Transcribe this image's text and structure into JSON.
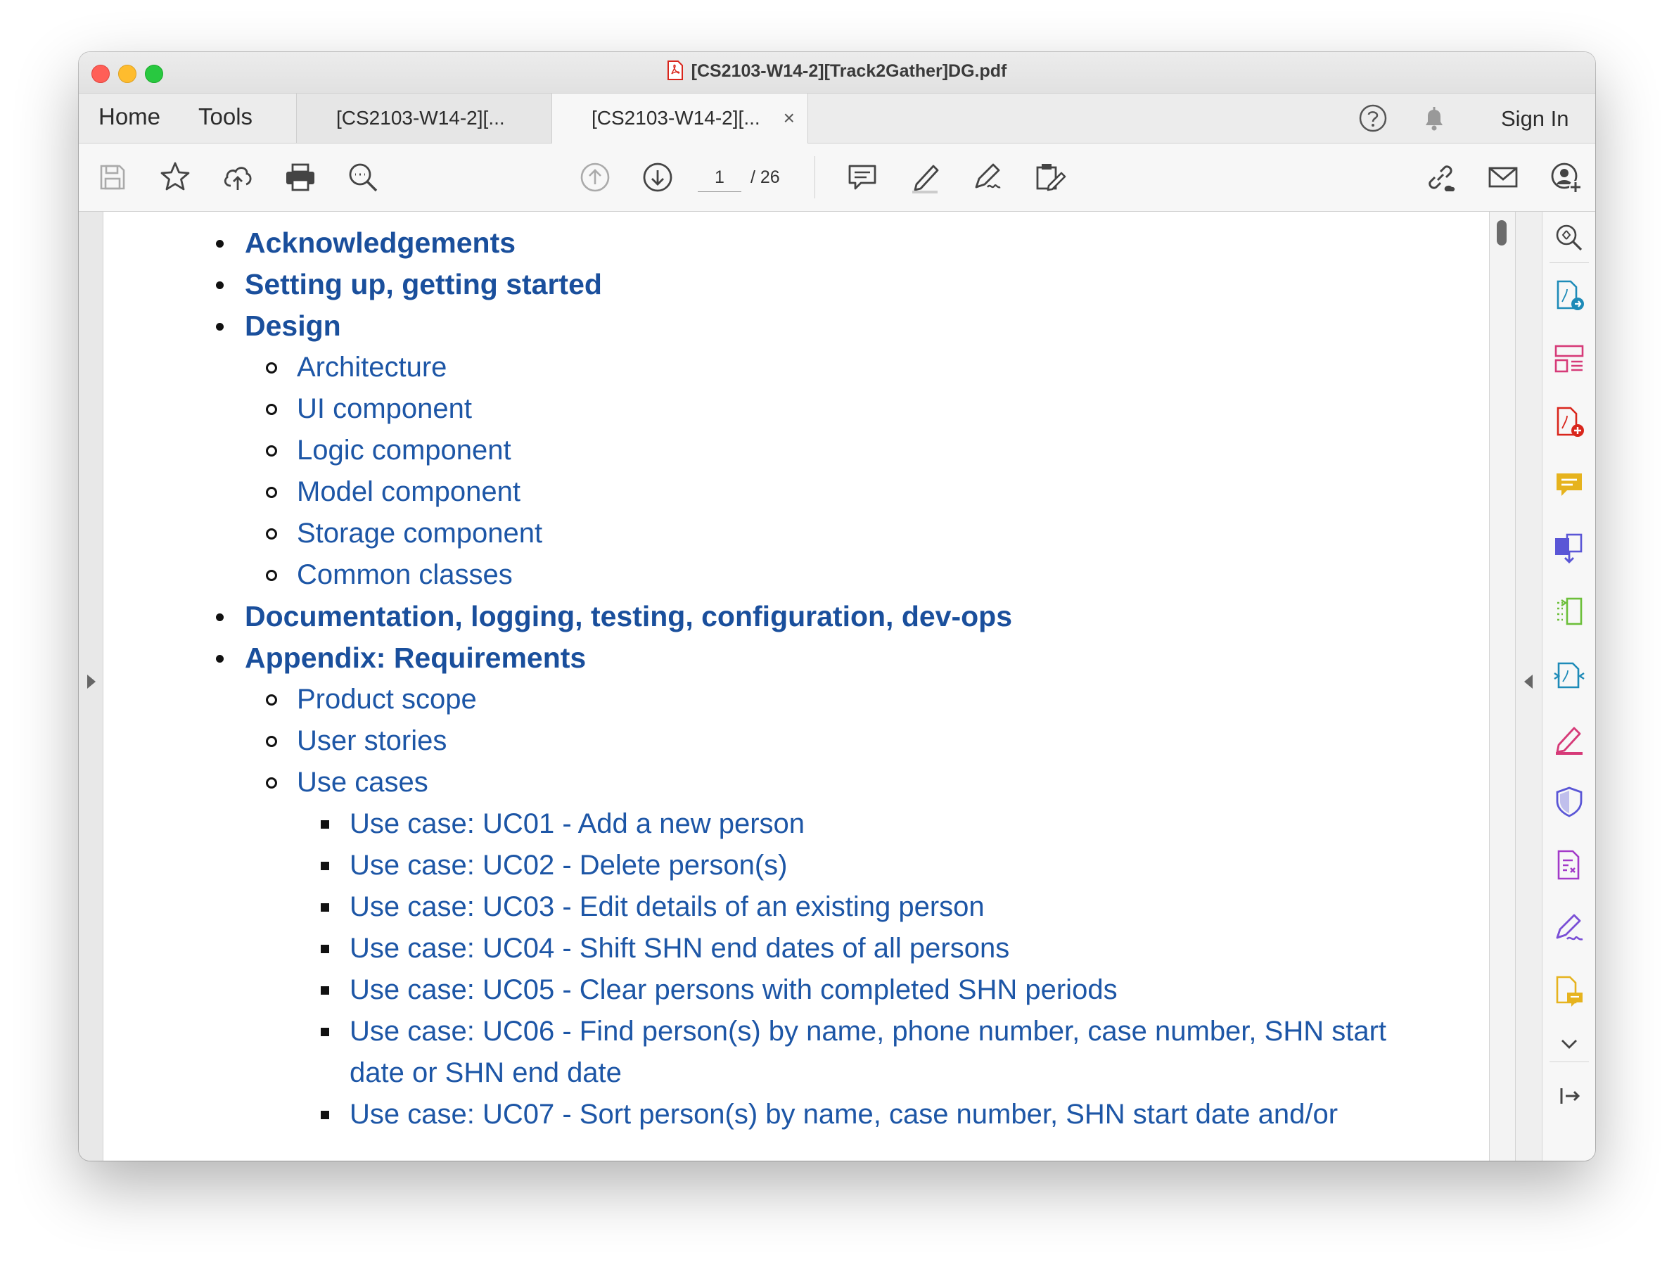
{
  "window": {
    "title": "[CS2103-W14-2][Track2Gather]DG.pdf"
  },
  "tabbar": {
    "home_label": "Home",
    "tools_label": "Tools",
    "tabs": [
      {
        "label": "[CS2103-W14-2][..."
      },
      {
        "label": "[CS2103-W14-2][...",
        "close": "×"
      }
    ],
    "signin_label": "Sign In"
  },
  "toolbar": {
    "current_page": "1",
    "total_pages": "/ 26",
    "icons": [
      "save-icon",
      "bookmark-star-icon",
      "upload-cloud-icon",
      "print-icon",
      "zoom-search-icon",
      "previous-page-icon",
      "next-page-icon",
      "comment-icon",
      "highlight-pen-icon",
      "sign-icon",
      "edit-pdf-icon",
      "share-link-icon",
      "email-icon",
      "add-user-icon"
    ]
  },
  "right_panel": {
    "icons": [
      "zoom-tool-icon",
      "export-pdf-icon",
      "organize-pages-icon",
      "create-pdf-icon",
      "comment-tool-icon",
      "combine-files-icon",
      "compress-icon",
      "scan-ocr-icon",
      "fill-sign-icon",
      "protect-icon",
      "prepare-form-icon",
      "request-signature-icon",
      "send-review-icon",
      "more-tools-chevron-icon",
      "collapse-panel-icon"
    ]
  },
  "colors": {
    "link": "#1d56a6",
    "link_bold": "#1a4f9c"
  },
  "toc": {
    "items": [
      {
        "level": 1,
        "text": "Acknowledgements"
      },
      {
        "level": 1,
        "text": "Setting up, getting started"
      },
      {
        "level": 1,
        "text": "Design"
      },
      {
        "level": 2,
        "text": "Architecture"
      },
      {
        "level": 2,
        "text": "UI component"
      },
      {
        "level": 2,
        "text": "Logic component"
      },
      {
        "level": 2,
        "text": "Model component"
      },
      {
        "level": 2,
        "text": "Storage component"
      },
      {
        "level": 2,
        "text": "Common classes"
      },
      {
        "level": 1,
        "text": "Documentation, logging, testing, configuration, dev-ops"
      },
      {
        "level": 1,
        "text": "Appendix: Requirements"
      },
      {
        "level": 2,
        "text": "Product scope"
      },
      {
        "level": 2,
        "text": "User stories"
      },
      {
        "level": 2,
        "text": "Use cases"
      },
      {
        "level": 3,
        "text": "Use case: UC01 - Add a new person"
      },
      {
        "level": 3,
        "text": "Use case: UC02 - Delete person(s)"
      },
      {
        "level": 3,
        "text": "Use case: UC03 - Edit details of an existing person"
      },
      {
        "level": 3,
        "text": "Use case: UC04 - Shift SHN end dates of all persons"
      },
      {
        "level": 3,
        "text": "Use case: UC05 - Clear persons with completed SHN periods"
      },
      {
        "level": 3,
        "text": "Use case: UC06 - Find person(s) by name, phone number, case number, SHN start"
      },
      {
        "level": 0,
        "text": "date or SHN end date"
      },
      {
        "level": 3,
        "text": "Use case: UC07 - Sort person(s) by name, case number, SHN start date and/or"
      }
    ]
  }
}
